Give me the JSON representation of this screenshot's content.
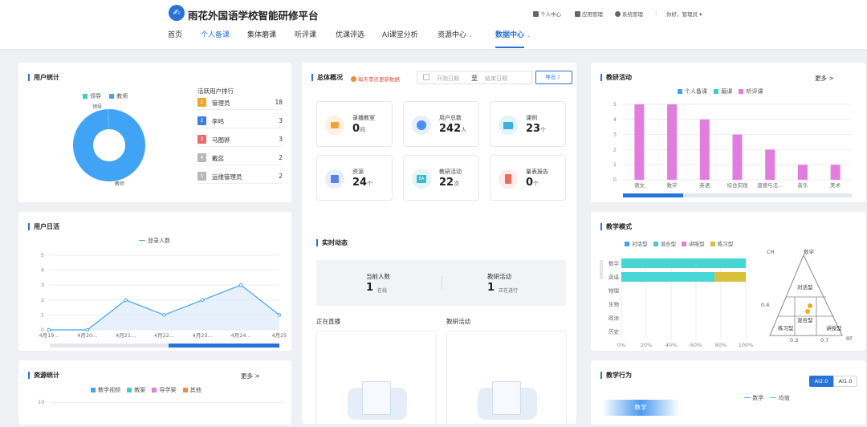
{
  "header": {
    "brand": "雨花外国语学校智能研修平台",
    "util": {
      "personal": "个人中心",
      "app_mgmt": "应用管理",
      "sys_mgmt": "系统管理",
      "greeting": "你好，管理员"
    },
    "nav": [
      "首页",
      "个人备课",
      "集体磨课",
      "听评课",
      "优课评选",
      "AI课堂分析",
      "资源中心",
      "数据中心"
    ]
  },
  "user_stats": {
    "title": "用户统计",
    "legend": [
      "领导",
      "教师"
    ],
    "donut_labels": {
      "leader": "领导",
      "teacher": "教师"
    },
    "rank_title": "活跃用户排行",
    "ranking": [
      {
        "rank": "1",
        "name": "管理员",
        "value": "18"
      },
      {
        "rank": "2",
        "name": "李鸣",
        "value": "3"
      },
      {
        "rank": "3",
        "name": "马图骅",
        "value": "3"
      },
      {
        "rank": "4",
        "name": "戴蕊",
        "value": "2"
      },
      {
        "rank": "5",
        "name": "运维管理员",
        "value": "2"
      }
    ]
  },
  "overview": {
    "title": "总体概况",
    "note": "每天零点更新数据",
    "start_placeholder": "开始日期",
    "sep": "至",
    "end_placeholder": "结束日期",
    "export": "导出 〉",
    "stats": [
      {
        "label": "录播教室",
        "value": "0",
        "unit": "间"
      },
      {
        "label": "用户总数",
        "value": "242",
        "unit": "人"
      },
      {
        "label": "课例",
        "value": "23",
        "unit": "个"
      },
      {
        "label": "资源",
        "value": "24",
        "unit": "个"
      },
      {
        "label": "教研活动",
        "value": "22",
        "unit": "次"
      },
      {
        "label": "量表报告",
        "value": "0",
        "unit": "个"
      }
    ]
  },
  "realtime": {
    "title": "实时动态",
    "current_label": "当前人数",
    "current_value": "1",
    "current_unit": "在线",
    "activity_label": "教研活动",
    "activity_value": "1",
    "activity_unit": "正在进行",
    "live_title": "正在直播",
    "activity_title": "教研活动"
  },
  "user_daily": {
    "title": "用户日活",
    "legend": "登录人数"
  },
  "research": {
    "title": "教研活动",
    "more": "更多 >",
    "legend": [
      "个人备课",
      "磨课",
      "听评课"
    ]
  },
  "teaching_mode": {
    "title": "教学模式",
    "legend": [
      "对话型",
      "混合型",
      "讲授型",
      "练习型"
    ],
    "tri": {
      "ch": "CH",
      "top": "数学",
      "mid": "对话型",
      "mixed": "混合型",
      "left": "练习型",
      "right": "讲授型",
      "y": "0.4",
      "x1": "0.3",
      "x2": "0.7",
      "rt": "RT"
    }
  },
  "resource_stats": {
    "title": "资源统计",
    "more": "更多 >",
    "legend": [
      "教学视频",
      "教案",
      "导学案",
      "其他"
    ]
  },
  "teaching_behavior": {
    "title": "教学行为",
    "tab1": "AI2.0",
    "tab2": "AI1.0",
    "subject": "数学",
    "legend": [
      "数学",
      "均值"
    ]
  },
  "colors": {
    "accent": "#2773d8",
    "cyan": "#3ecdc8",
    "blue": "#41a3f5",
    "pink": "#e27de0",
    "yellow": "#d9c03a",
    "teal": "#47d6d6"
  },
  "chart_data": [
    {
      "type": "pie",
      "categories": [
        "领导",
        "教师"
      ],
      "values": [
        1,
        241
      ]
    },
    {
      "type": "line",
      "title": "用户日活",
      "x": [
        "4月19...",
        "4月20...",
        "4月21...",
        "4月22...",
        "4月23...",
        "4月24...",
        "4月25"
      ],
      "series": [
        {
          "name": "登录人数",
          "values": [
            0,
            0,
            2,
            1,
            2,
            3,
            1
          ]
        }
      ],
      "ylim": [
        0,
        5
      ],
      "yticks": [
        "0",
        "1",
        "2",
        "3",
        "4",
        "5"
      ]
    },
    {
      "type": "bar",
      "title": "教研活动",
      "categories": [
        "语文",
        "数学",
        "英语",
        "综合实践",
        "道德与法...",
        "音乐",
        "美术"
      ],
      "series": [
        {
          "name": "听评课",
          "values": [
            5,
            5,
            4,
            3,
            2,
            1,
            1
          ]
        }
      ],
      "ylim": [
        0,
        5
      ],
      "yticks": [
        "0",
        "1",
        "2",
        "3",
        "4",
        "5"
      ]
    },
    {
      "type": "bar",
      "title": "教学模式",
      "orientation": "horizontal",
      "stacked": true,
      "categories": [
        "数学",
        "英语",
        "物理",
        "生物",
        "政治",
        "历史"
      ],
      "series": [
        {
          "name": "对话型",
          "values": [
            0,
            0,
            0,
            0,
            0,
            0
          ]
        },
        {
          "name": "混合型",
          "values": [
            100,
            75,
            0,
            0,
            0,
            0
          ]
        },
        {
          "name": "讲授型",
          "values": [
            0,
            0,
            0,
            0,
            0,
            0
          ]
        },
        {
          "name": "练习型",
          "values": [
            0,
            25,
            0,
            0,
            0,
            0
          ]
        }
      ],
      "xticks": [
        "0%",
        "20%",
        "40%",
        "60%",
        "80%",
        "100%"
      ]
    },
    {
      "type": "bar",
      "title": "资源统计",
      "yticks": [
        "10"
      ]
    }
  ]
}
